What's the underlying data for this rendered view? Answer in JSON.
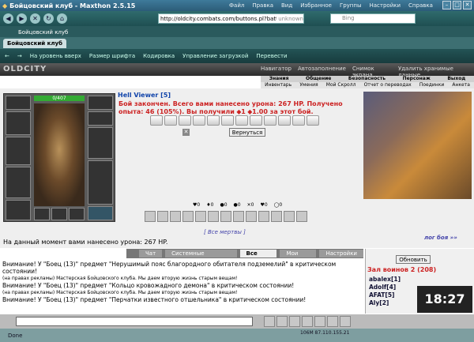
{
  "window": {
    "title": "Бойцовский клуб - Maxthon 2.5.15"
  },
  "menu": [
    "Файл",
    "Правка",
    "Вид",
    "Избранное",
    "Группы",
    "Настройки",
    "Справка"
  ],
  "address": {
    "url": "http://oldcity.combats.com/buttons.pl?battl",
    "go": "unknown"
  },
  "search": {
    "placeholder": "Bing"
  },
  "tabs": [
    {
      "label": "Бойцовский клуб"
    },
    {
      "label": "Бойцовский клуб"
    }
  ],
  "toolbar": [
    "На уровень вверх",
    "Размер шрифта",
    "Кодировка",
    "Управление загрузкой",
    "Перевести"
  ],
  "game": {
    "logo": "OLDCITY",
    "tools": [
      "Навигатор",
      "Автозаполнение",
      "Снимок экрана",
      "Удалить хранимые данные..."
    ],
    "nav1": [
      "Знания",
      "Общение",
      "Безопасность",
      "Персонаж",
      "Выход"
    ],
    "nav2": [
      "Инвентарь",
      "Умения",
      "Мой Скролл",
      "Отчет о переводах",
      "Поединки",
      "Анкета"
    ],
    "hp": "0/407",
    "player_name": "Hell Viewer [5]",
    "battle_message": "Бой закончен. Всего вами нанесено урона: 267 HP. Получено опыта: 46 (105%). Вы получили ⬥1 ⬥1.00 за этот бой.",
    "back_button": "Вернуться",
    "stats": [
      "0",
      "0",
      "0",
      "0",
      "0",
      "0",
      "0"
    ],
    "all_dead": "[ Все мертвы ]",
    "log_link": "лог боя »»",
    "damage_line": "На данный момент вами нанесено урона: 267 HP."
  },
  "chat_tabs": [
    "Чат",
    "Системные сообщения",
    "Все логи",
    "Мои логи",
    "Настройки"
  ],
  "chat_lines": [
    {
      "text": "Внимание! У \"Боец (13)\" предмет \"Нерушимый пояс благородного обитателя подземелий\" в критическом состоянии!",
      "style": ""
    },
    {
      "text": "(на правах рекламы) Мастерская Бойцовского клуба. Мы даем вторую жизнь старым вещам!",
      "style": "small"
    },
    {
      "text": "Внимание! У \"Боец (13)\" предмет \"Кольцо кровожадного демона\" в критическом состоянии!",
      "style": ""
    },
    {
      "text": "(на правах рекламы) Мастерская Бойцовского клуба. Мы даем вторую жизнь старым вещам!",
      "style": "small"
    },
    {
      "text": "Внимание! У \"Боец (13)\" предмет \"Перчатки известного отшельника\" в критическом состоянии!",
      "style": ""
    }
  ],
  "roster": {
    "refresh": "Обновить",
    "title": "Зал воинов 2 (208)",
    "players": [
      "abalex[1]",
      "Adolf[4]",
      "AFAT[5]",
      "Aly[2]"
    ]
  },
  "clock": "18:27",
  "status": {
    "left": "Done",
    "right": "106M 87.110.155.21"
  },
  "colors": {
    "title_bar": "#2c5c78",
    "battle_message": "#cc2222"
  }
}
